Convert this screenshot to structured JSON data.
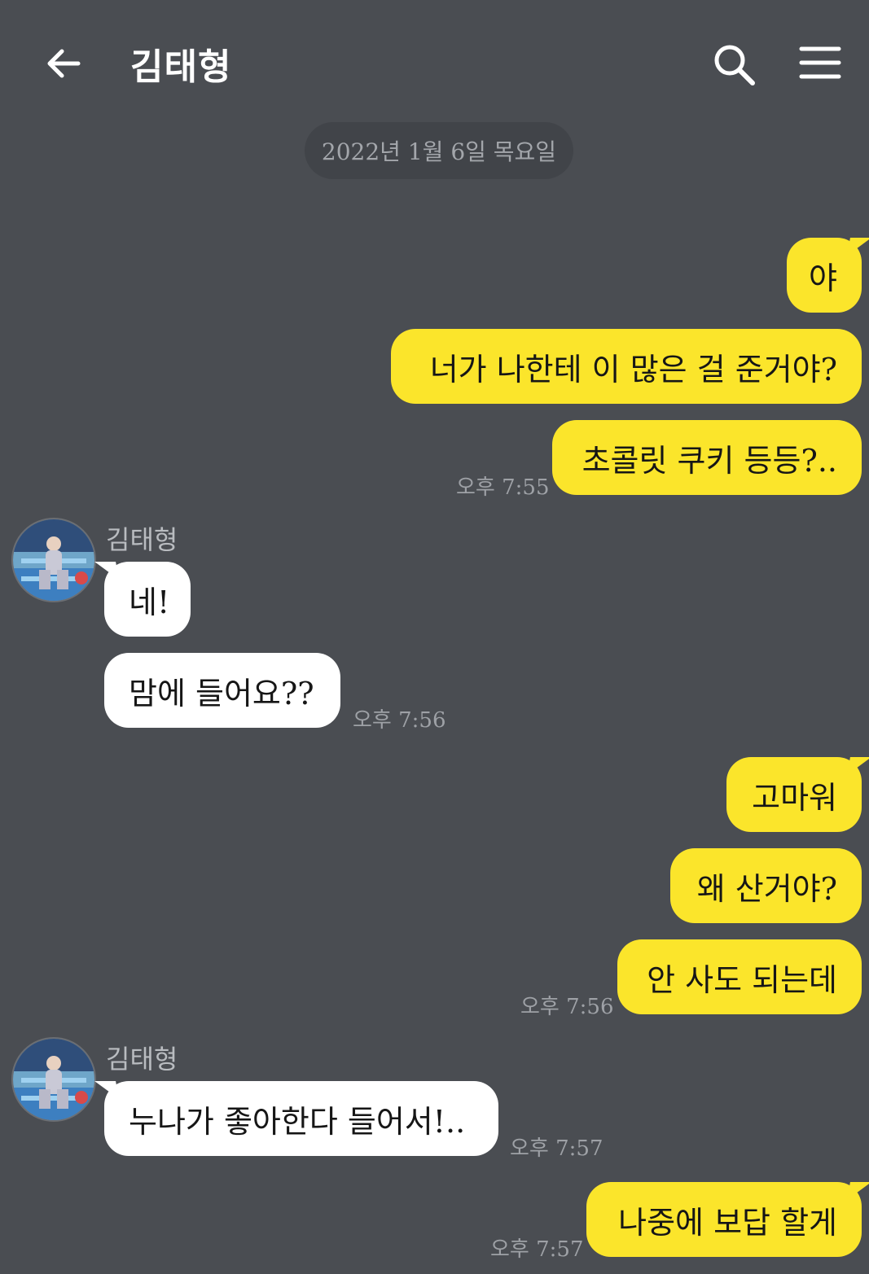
{
  "header": {
    "back_icon": "arrow-left-icon",
    "title": "김태형",
    "search_icon": "search-icon",
    "menu_icon": "hamburger-menu-icon"
  },
  "chat": {
    "date_divider": "2022년 1월 6일 목요일",
    "sender_name": "김태형",
    "colors": {
      "my_bubble": "#fbe52b",
      "their_bubble": "#ffffff",
      "background": "#4a4d52"
    },
    "messages": [
      {
        "from": "me",
        "text": "야"
      },
      {
        "from": "me",
        "text": "너가 나한테 이 많은 걸 준거야?"
      },
      {
        "from": "me",
        "text": "초콜릿 쿠키 등등?..",
        "time": "오후 7:55"
      },
      {
        "from": "them",
        "text": "네!"
      },
      {
        "from": "them",
        "text": "맘에 들어요??",
        "time": "오후 7:56"
      },
      {
        "from": "me",
        "text": "고마워"
      },
      {
        "from": "me",
        "text": "왜 산거야?"
      },
      {
        "from": "me",
        "text": "안 사도 되는데",
        "time": "오후 7:56"
      },
      {
        "from": "them",
        "text": "누나가 좋아한다 들어서!..",
        "time": "오후 7:57"
      },
      {
        "from": "me",
        "text": "나중에 보답 할게",
        "time": "오후 7:57"
      }
    ]
  }
}
